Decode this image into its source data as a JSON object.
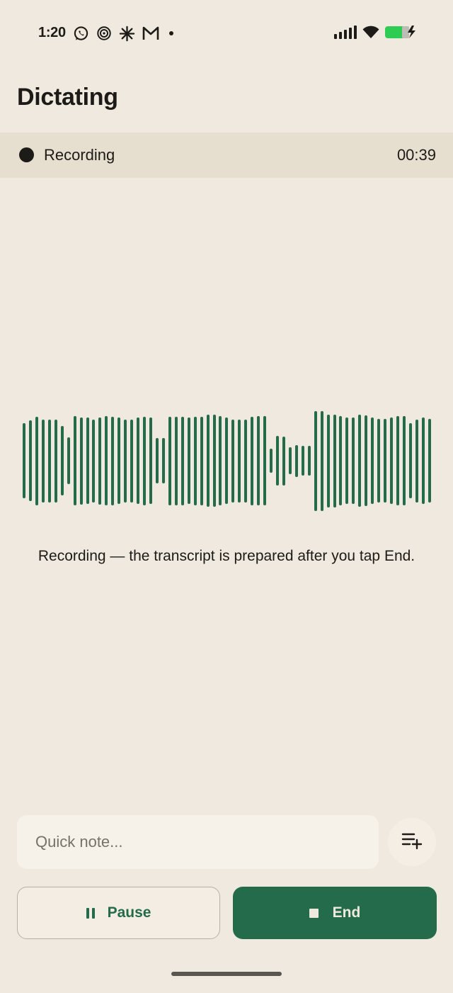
{
  "status_bar": {
    "time": "1:20",
    "left_icons": [
      "whatsapp-icon",
      "spiral-icon",
      "asterisk-icon",
      "gmail-icon",
      "dot-icon"
    ],
    "right_icons": [
      "signal-icon",
      "wifi-icon",
      "battery-charging-icon"
    ],
    "battery_color": "#2ecc52"
  },
  "header": {
    "title": "Dictating"
  },
  "recording": {
    "label": "Recording",
    "timer": "00:39"
  },
  "waveform": {
    "color": "#236b4b",
    "levels": [
      0.66,
      0.71,
      0.78,
      0.73,
      0.73,
      0.73,
      0.61,
      0.41,
      0.79,
      0.77,
      0.76,
      0.73,
      0.77,
      0.79,
      0.78,
      0.76,
      0.73,
      0.73,
      0.76,
      0.78,
      0.76,
      0.4,
      0.4,
      0.78,
      0.78,
      0.78,
      0.76,
      0.78,
      0.78,
      0.81,
      0.81,
      0.79,
      0.76,
      0.73,
      0.73,
      0.73,
      0.78,
      0.79,
      0.79,
      0.21,
      0.44,
      0.43,
      0.24,
      0.28,
      0.26,
      0.26,
      0.88,
      0.88,
      0.82,
      0.82,
      0.79,
      0.76,
      0.76,
      0.81,
      0.8,
      0.76,
      0.74,
      0.74,
      0.76,
      0.79,
      0.79,
      0.66,
      0.73,
      0.76,
      0.74
    ]
  },
  "caption": "Recording — the transcript is prepared after you tap End.",
  "quick_note": {
    "placeholder": "Quick note..."
  },
  "buttons": {
    "pause_label": "Pause",
    "end_label": "End",
    "accent_color": "#236b4b"
  }
}
